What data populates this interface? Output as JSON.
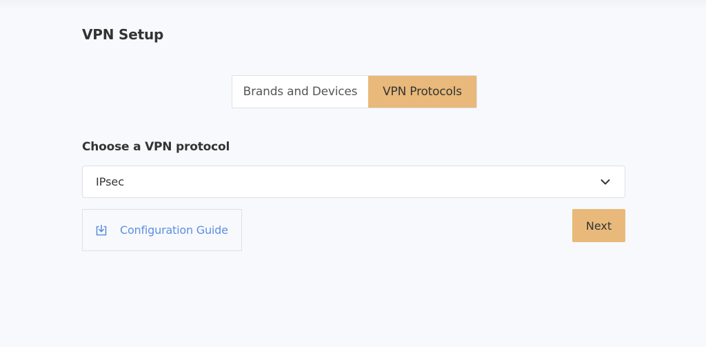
{
  "header": {
    "title": "VPN Setup"
  },
  "tabs": [
    {
      "label": "Brands and Devices",
      "selected": false
    },
    {
      "label": "VPN Protocols",
      "selected": true
    }
  ],
  "protocol_section": {
    "label": "Choose a VPN protocol",
    "select": {
      "value": "IPsec",
      "icon": "chevron-down-icon"
    }
  },
  "actions": {
    "guide_label": "Configuration Guide",
    "guide_icon": "download-icon",
    "next_label": "Next"
  },
  "colors": {
    "accent": "#e8b97a",
    "link": "#5b8fe0",
    "border": "#dcdfe6",
    "background": "#f8f9fc",
    "text": "#333333"
  }
}
